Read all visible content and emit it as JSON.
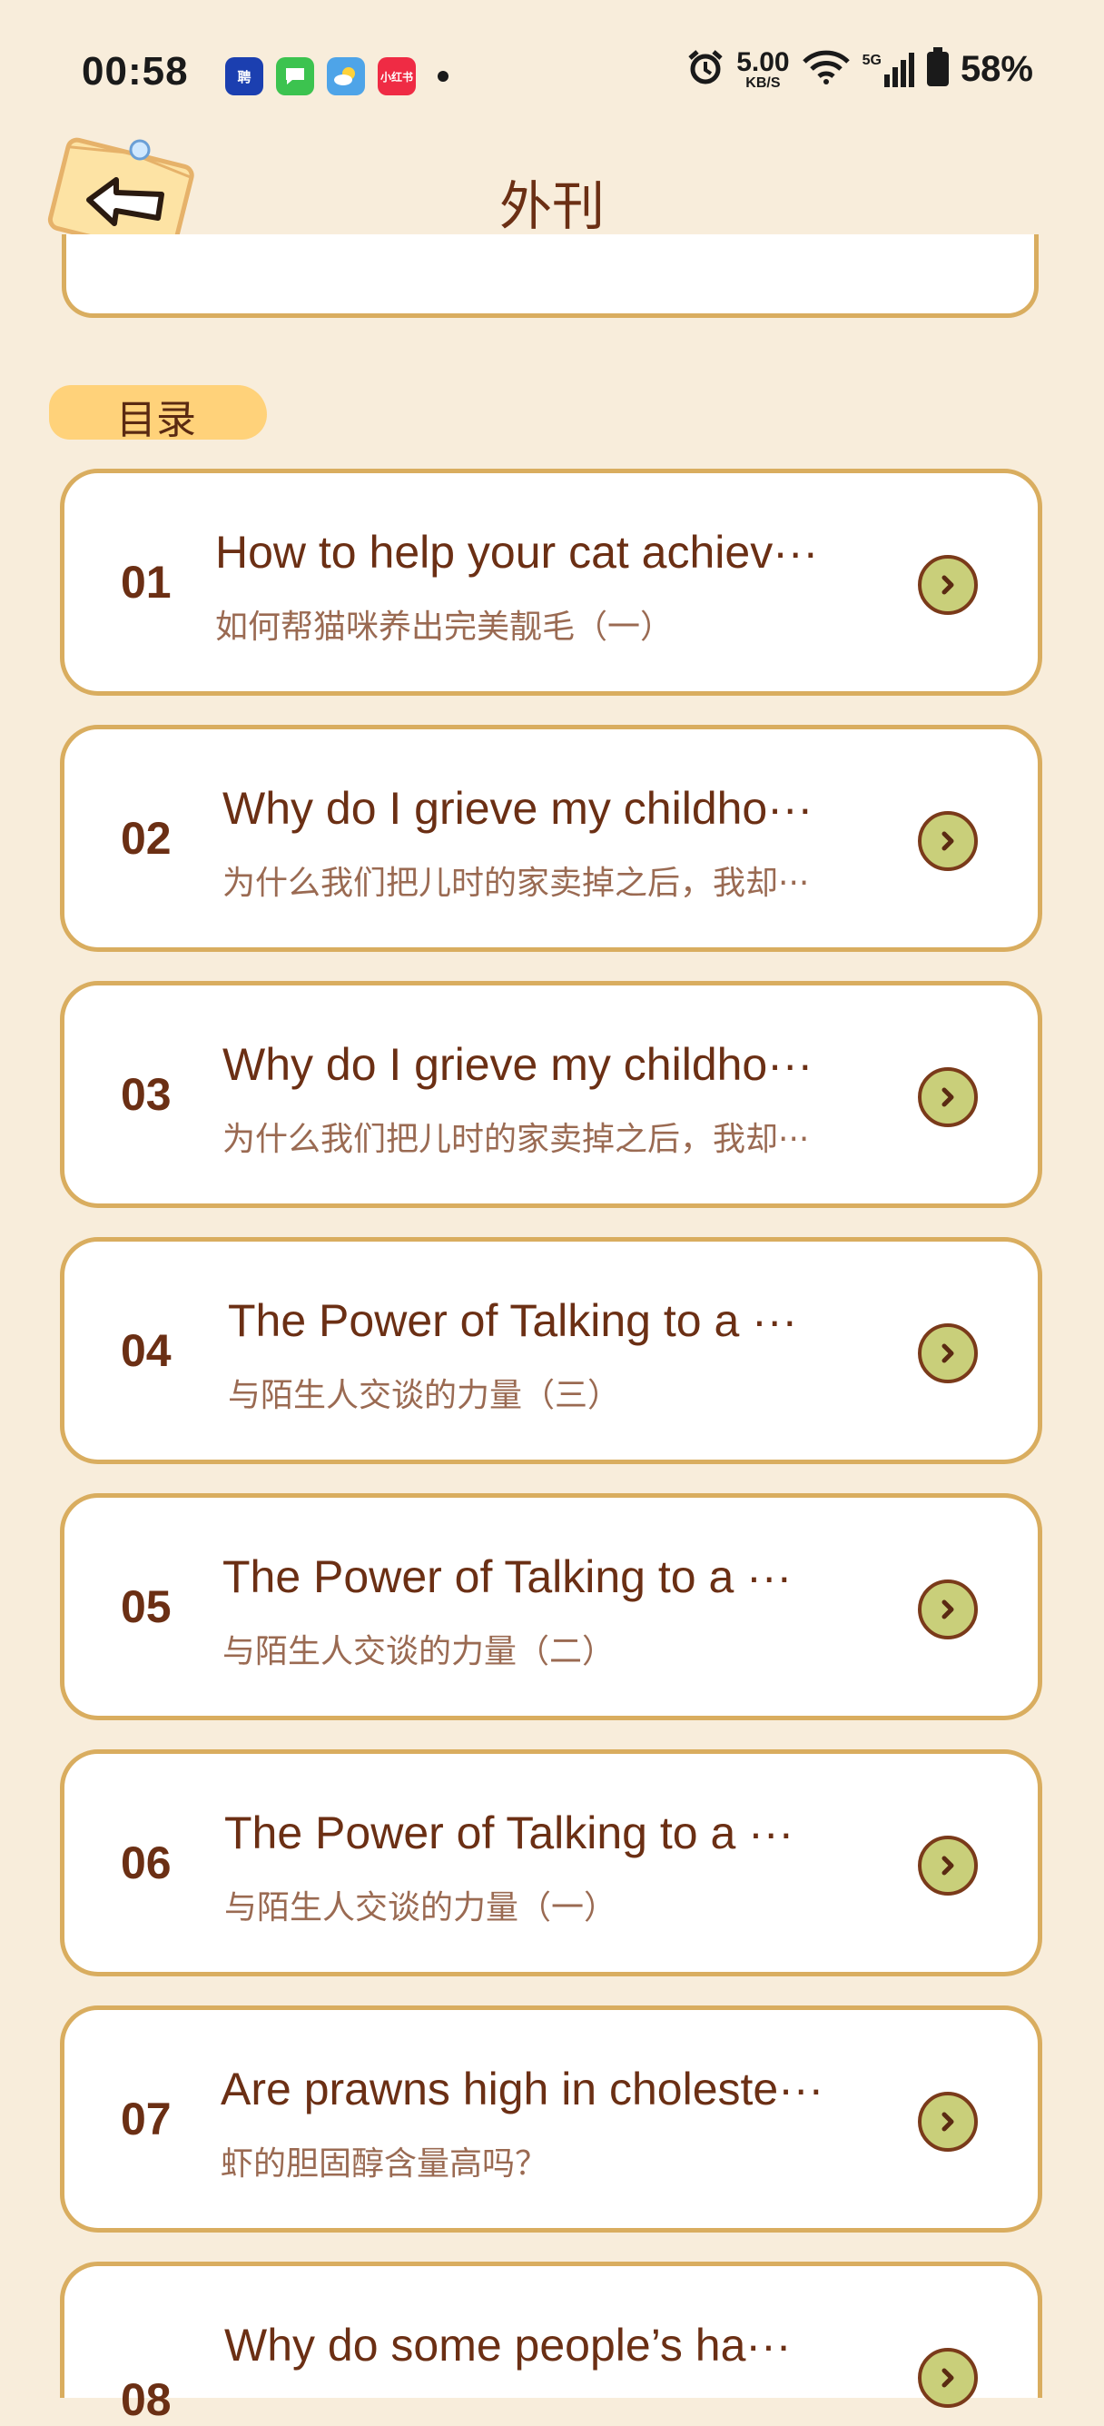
{
  "status_bar": {
    "time": "00:58",
    "app_icons": [
      {
        "name": "zhipin-app-icon",
        "label": "聘"
      },
      {
        "name": "messages-app-icon",
        "label": ""
      },
      {
        "name": "weather-app-icon",
        "label": ""
      },
      {
        "name": "xiaohongshu-app-icon",
        "label": "小红书"
      }
    ],
    "net_speed_value": "5.00",
    "net_speed_unit": "KB/S",
    "network_type": "5G",
    "battery": "58%"
  },
  "header": {
    "title": "外刊",
    "back_icon": "back-arrow-icon"
  },
  "section": {
    "label": "目录"
  },
  "items": [
    {
      "num": "01",
      "title": "How to help your cat achiev···",
      "subtitle": "如何帮猫咪养出完美靓毛（一）"
    },
    {
      "num": "02",
      "title": "Why do I grieve my childho···",
      "subtitle": "为什么我们把儿时的家卖掉之后，我却···"
    },
    {
      "num": "03",
      "title": "Why do I grieve my childho···",
      "subtitle": "为什么我们把儿时的家卖掉之后，我却···"
    },
    {
      "num": "04",
      "title": "The Power of Talking to a ···",
      "subtitle": "与陌生人交谈的力量（三）"
    },
    {
      "num": "05",
      "title": "The Power of Talking to a ···",
      "subtitle": "与陌生人交谈的力量（二）"
    },
    {
      "num": "06",
      "title": "The Power of Talking to a ···",
      "subtitle": "与陌生人交谈的力量（一）"
    },
    {
      "num": "07",
      "title": "Are prawns high in choleste···",
      "subtitle": "虾的胆固醇含量高吗？"
    },
    {
      "num": "08",
      "title": "Why do some people’s ha···",
      "subtitle": ""
    }
  ],
  "colors": {
    "background": "#f8eddb",
    "card_border": "#d9ad5f",
    "text_primary": "#6b2f14",
    "text_secondary": "#9a6a52",
    "go_button": "#c9cf7a"
  }
}
